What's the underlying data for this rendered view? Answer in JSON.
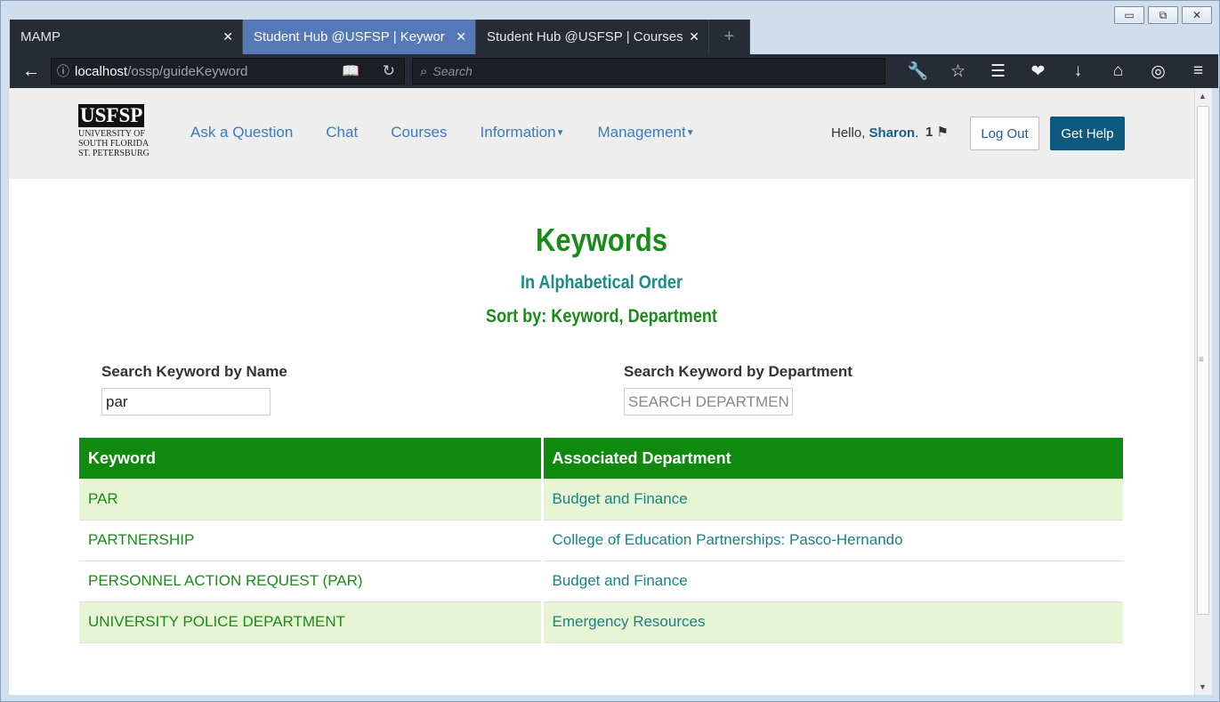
{
  "window": {
    "minimize": "▭",
    "restore": "⧉",
    "close": "✕"
  },
  "tabs": [
    {
      "title": "MAMP",
      "close": "✕"
    },
    {
      "title": "Student Hub @USFSP | Keyword",
      "close": "✕"
    },
    {
      "title": "Student Hub @USFSP | Courses",
      "close": "✕"
    },
    {
      "title": "+"
    }
  ],
  "urlbar": {
    "host": "localhost",
    "path": "/ossp/guideKeyword"
  },
  "searchbar": {
    "placeholder": "Search"
  },
  "site": {
    "logo_mark": "USFSP",
    "logo_line1": "UNIVERSITY OF",
    "logo_line2": "SOUTH FLORIDA",
    "logo_line3": "ST. PETERSBURG",
    "menu": [
      "Ask a Question",
      "Chat",
      "Courses",
      "Information",
      "Management"
    ],
    "hello_prefix": "Hello, ",
    "user": "Sharon",
    "hello_suffix": ".",
    "notif_count": "1",
    "logout": "Log Out",
    "help": "Get Help"
  },
  "page": {
    "title": "Keywords",
    "subtitle": "In Alphabetical Order",
    "sort": "Sort by: Keyword, Department",
    "search_name_label": "Search Keyword by Name",
    "search_name_value": "par",
    "search_dept_label": "Search Keyword by Department",
    "search_dept_placeholder": "SEARCH DEPARTMENT"
  },
  "table": {
    "headers": [
      "Keyword",
      "Associated Department"
    ],
    "rows": [
      {
        "keyword": "PAR",
        "department": "Budget and Finance"
      },
      {
        "keyword": "PARTNERSHIP",
        "department": "College of Education Partnerships: Pasco-Hernando"
      },
      {
        "keyword": "PERSONNEL ACTION REQUEST (PAR)",
        "department": "Budget and Finance"
      },
      {
        "keyword": "UNIVERSITY POLICE DEPARTMENT",
        "department": "Emergency Resources"
      }
    ]
  },
  "colors": {
    "accent_green": "#1a8a1a",
    "header_green": "#0f8a0f",
    "teal": "#1a8080",
    "link_blue": "#3c7abf",
    "help_btn": "#0e5a7e"
  }
}
